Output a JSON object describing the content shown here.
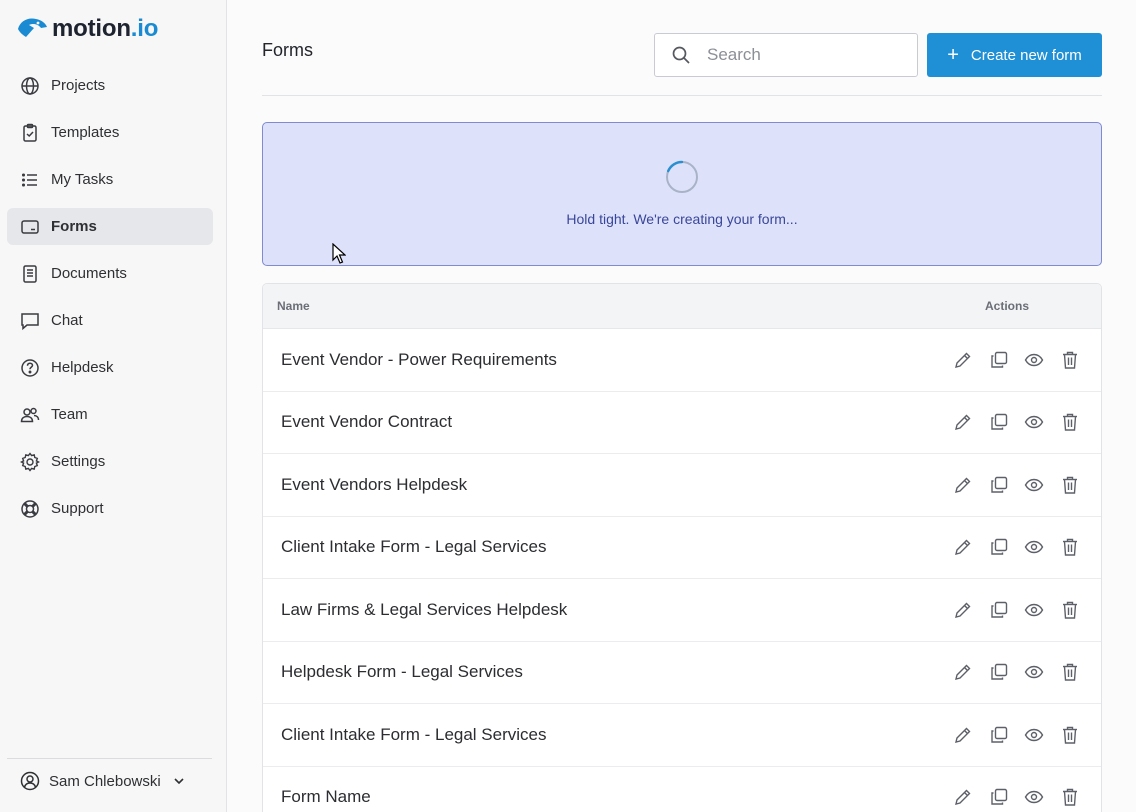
{
  "app": {
    "brand_prefix": "motion",
    "brand_suffix": ".io"
  },
  "sidebar": {
    "items": [
      {
        "label": "Projects",
        "icon": "globe-icon",
        "active": false
      },
      {
        "label": "Templates",
        "icon": "clipboard-check-icon",
        "active": false
      },
      {
        "label": "My Tasks",
        "icon": "list-icon",
        "active": false
      },
      {
        "label": "Forms",
        "icon": "form-icon",
        "active": true
      },
      {
        "label": "Documents",
        "icon": "document-icon",
        "active": false
      },
      {
        "label": "Chat",
        "icon": "chat-icon",
        "active": false
      },
      {
        "label": "Helpdesk",
        "icon": "question-circle-icon",
        "active": false
      },
      {
        "label": "Team",
        "icon": "team-icon",
        "active": false
      },
      {
        "label": "Settings",
        "icon": "gear-icon",
        "active": false
      },
      {
        "label": "Support",
        "icon": "lifebuoy-icon",
        "active": false
      }
    ],
    "user": {
      "name": "Sam Chlebowski"
    }
  },
  "header": {
    "title": "Forms",
    "search_placeholder": "Search",
    "create_label": "Create new form"
  },
  "banner": {
    "message": "Hold tight. We're creating your form..."
  },
  "table": {
    "columns": {
      "name": "Name",
      "actions": "Actions"
    },
    "rows": [
      {
        "name": "Event Vendor - Power Requirements"
      },
      {
        "name": "Event Vendor Contract"
      },
      {
        "name": "Event Vendors Helpdesk"
      },
      {
        "name": "Client Intake Form - Legal Services"
      },
      {
        "name": "Law Firms & Legal Services Helpdesk"
      },
      {
        "name": "Helpdesk Form - Legal Services"
      },
      {
        "name": "Client Intake Form - Legal Services"
      },
      {
        "name": "Form Name"
      }
    ]
  },
  "colors": {
    "accent": "#1f8fd6",
    "banner_bg": "#dde2fa",
    "banner_text": "#3a4699"
  }
}
